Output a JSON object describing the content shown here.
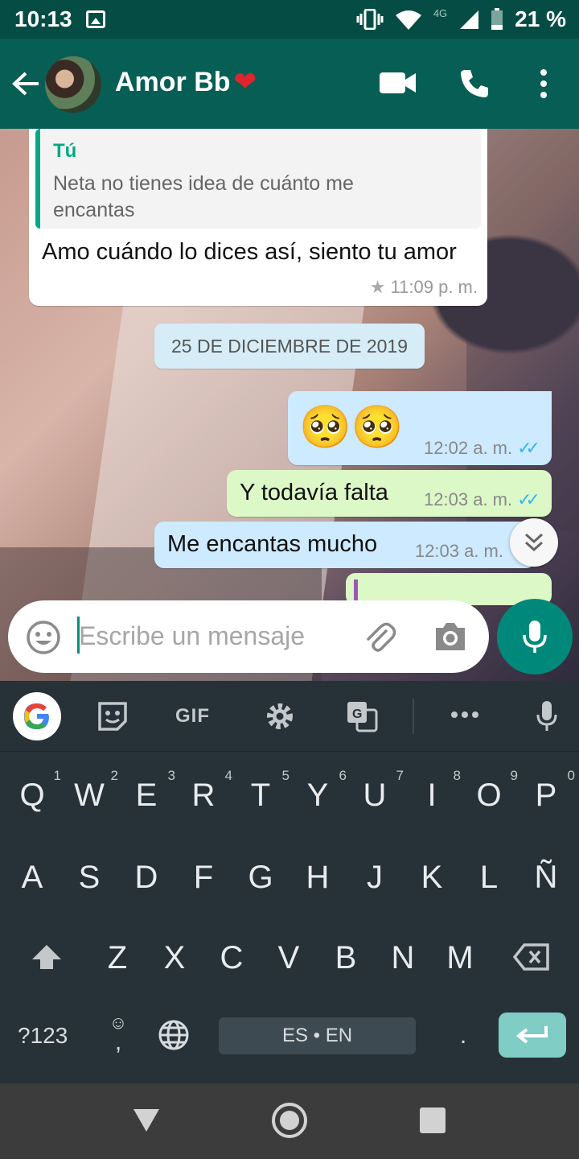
{
  "status_bar": {
    "time": "10:13",
    "network": "4G",
    "battery": "21 %"
  },
  "header": {
    "contact_name": "Amor Bb",
    "contact_emoji": "❤",
    "icons": [
      "back-arrow-icon",
      "video-call-icon",
      "phone-icon",
      "more-vert-icon"
    ]
  },
  "messages": {
    "reply": {
      "quoted_author": "Tú",
      "quoted_text": "Neta no tienes idea de cuánto me encantas",
      "text": "Amo cuándo lo dices así, siento tu amor",
      "time": "11:09 p. m.",
      "starred": true
    },
    "date_divider": "25 DE DICIEMBRE DE 2019",
    "emoji_message": {
      "text": "🥺🥺",
      "time": "12:02 a. m."
    },
    "falta_message": {
      "text": "Y todavía falta",
      "time": "12:03 a. m."
    },
    "mucho_message": {
      "text": "Me encantas mucho",
      "time": "12:03 a. m."
    }
  },
  "composer": {
    "placeholder": "Escribe un mensaje"
  },
  "keyboard": {
    "row1": [
      {
        "k": "Q",
        "n": "1"
      },
      {
        "k": "W",
        "n": "2"
      },
      {
        "k": "E",
        "n": "3"
      },
      {
        "k": "R",
        "n": "4"
      },
      {
        "k": "T",
        "n": "5"
      },
      {
        "k": "Y",
        "n": "6"
      },
      {
        "k": "U",
        "n": "7"
      },
      {
        "k": "I",
        "n": "8"
      },
      {
        "k": "O",
        "n": "9"
      },
      {
        "k": "P",
        "n": "0"
      }
    ],
    "row2": [
      "A",
      "S",
      "D",
      "F",
      "G",
      "H",
      "J",
      "K",
      "L",
      "Ñ"
    ],
    "row3": [
      "Z",
      "X",
      "C",
      "V",
      "B",
      "N",
      "M"
    ],
    "toolbar_gif": "GIF",
    "symbols": "?123",
    "comma": ",",
    "space_label": "ES • EN",
    "period": "."
  },
  "colors": {
    "header": "#075e54",
    "status_bar": "#054d44",
    "outgoing_bubble": "#dcf8c6",
    "read_ticks": "#34b7f1",
    "mic_button": "#00897b",
    "keyboard_bg": "#263238"
  }
}
